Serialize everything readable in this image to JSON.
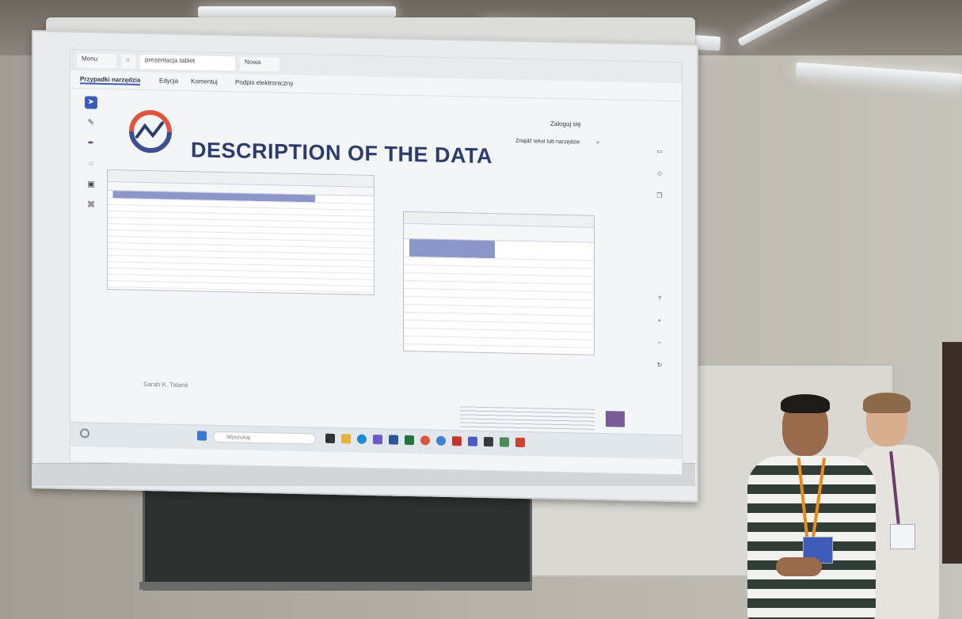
{
  "app": {
    "tabs": [
      "Menu",
      "prezentacja tablet",
      "Nowa"
    ],
    "menu_items": [
      "Przypadki narzędzia",
      "Edycja",
      "Komentuj",
      "Podpis elektroniczny"
    ],
    "share_button": "Zaloguj się",
    "search_text": "Znajdź tekst lub narzędzie"
  },
  "slide": {
    "title": "DESCRIPTION OF THE DATA",
    "footer_left": "Sarah K. Talanit"
  },
  "taskbar": {
    "search_placeholder": "Wyszukaj"
  },
  "colors": {
    "slide_title": "#2f3c6b",
    "logo_ring_a": "#e0533c",
    "logo_ring_b": "#3f4f8f",
    "shirt_stripe": "#2f3d35",
    "lanyard": "#e88a1d"
  }
}
